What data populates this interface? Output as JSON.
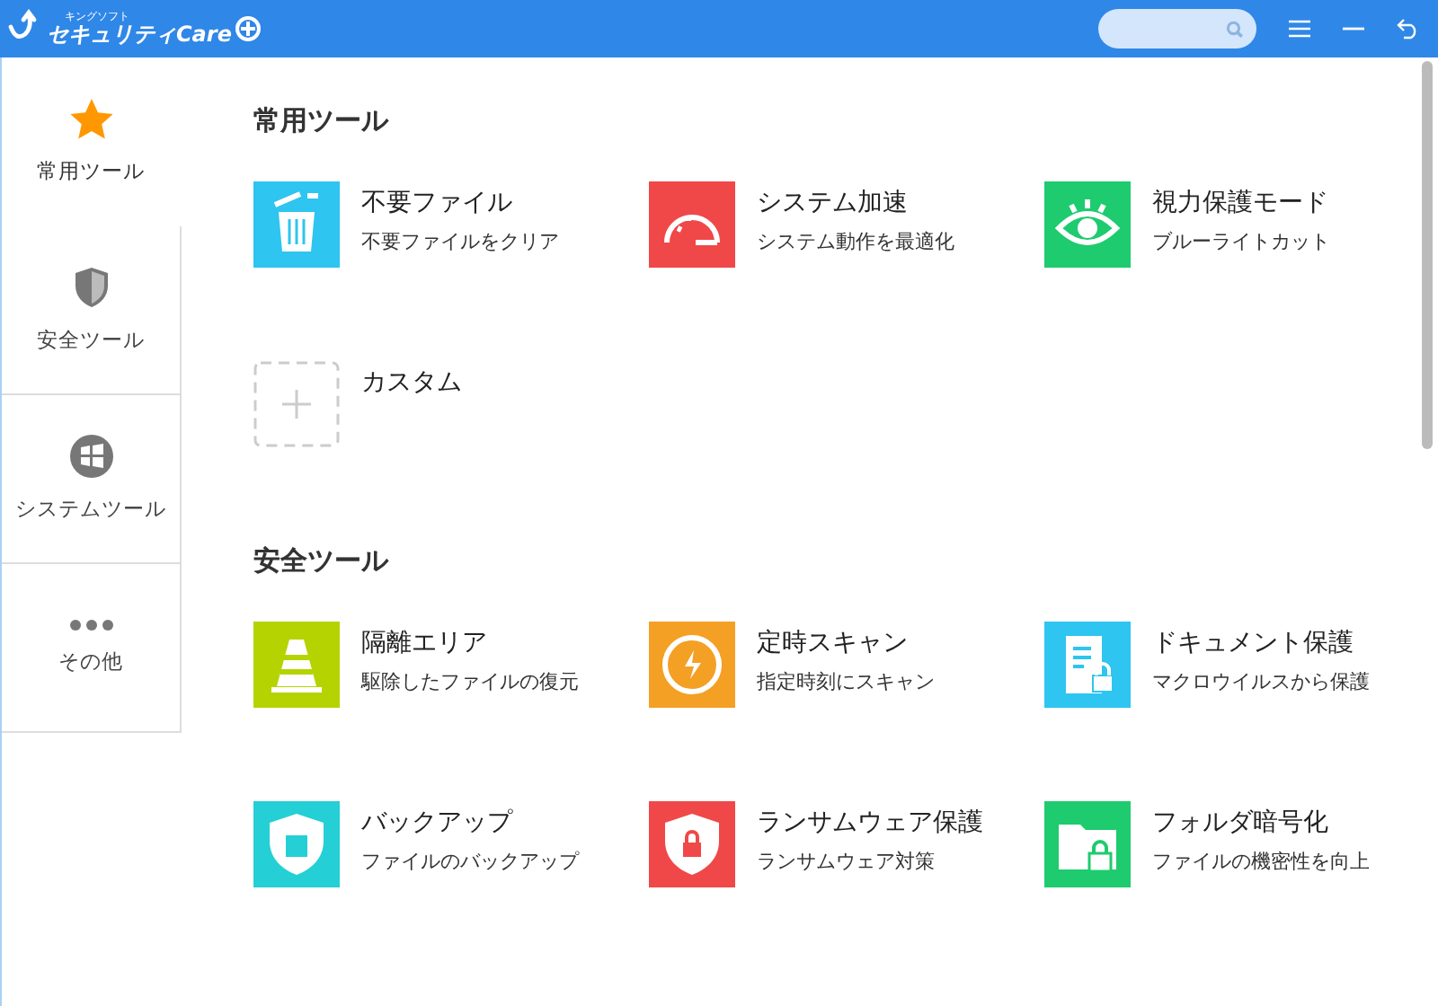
{
  "titlebar": {
    "logo_small": "キングソフト",
    "logo_main": "セキュリティCare"
  },
  "sidebar": {
    "items": [
      {
        "label": "常用ツール",
        "selected": true
      },
      {
        "label": "安全ツール",
        "selected": false
      },
      {
        "label": "システムツール",
        "selected": false
      },
      {
        "label": "その他",
        "selected": false
      }
    ]
  },
  "sections": [
    {
      "title": "常用ツール",
      "tools": [
        {
          "kind": "tool",
          "name": "不要ファイル",
          "desc": "不要ファイルをクリア",
          "color": "#2ec5f0"
        },
        {
          "kind": "tool",
          "name": "システム加速",
          "desc": "システム動作を最適化",
          "color": "#f04848"
        },
        {
          "kind": "tool",
          "name": "視力保護モード",
          "desc": "ブルーライトカット",
          "color": "#1ecb6e"
        },
        {
          "kind": "custom",
          "name": "カスタム"
        }
      ]
    },
    {
      "title": "安全ツール",
      "tools": [
        {
          "kind": "tool",
          "name": "隔離エリア",
          "desc": "駆除したファイルの復元",
          "color": "#b5d300"
        },
        {
          "kind": "tool",
          "name": "定時スキャン",
          "desc": "指定時刻にスキャン",
          "color": "#f4a024"
        },
        {
          "kind": "tool",
          "name": "ドキュメント保護",
          "desc": "マクロウイルスから保護",
          "color": "#2ec5f0"
        },
        {
          "kind": "tool",
          "name": "バックアップ",
          "desc": "ファイルのバックアップ",
          "color": "#24cfd6"
        },
        {
          "kind": "tool",
          "name": "ランサムウェア保護",
          "desc": "ランサムウェア対策",
          "color": "#f04848"
        },
        {
          "kind": "tool",
          "name": "フォルダ暗号化",
          "desc": "ファイルの機密性を向上",
          "color": "#1ecb6e"
        }
      ]
    }
  ]
}
